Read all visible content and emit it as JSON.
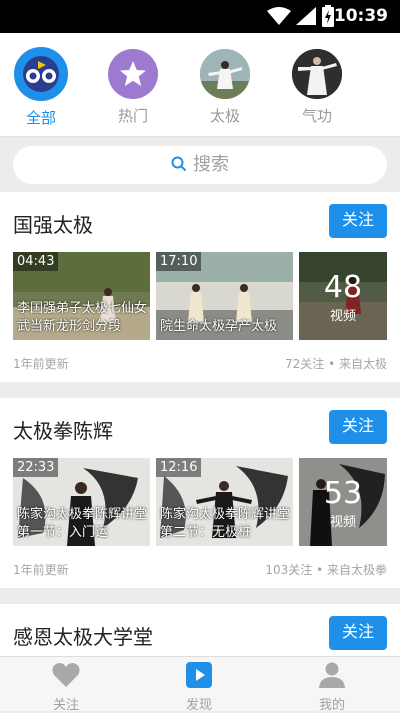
{
  "status_bar": {
    "time": "10:39"
  },
  "categories": [
    {
      "label": "全部",
      "active": true
    },
    {
      "label": "热门",
      "active": false
    },
    {
      "label": "太极",
      "active": false
    },
    {
      "label": "气功",
      "active": false
    }
  ],
  "search": {
    "placeholder": "搜索"
  },
  "cards": [
    {
      "title": "国强太极",
      "follow": "关注",
      "videos": [
        {
          "duration": "04:43",
          "caption": "李国强弟子太极七仙女武当新龙形剑分段"
        },
        {
          "duration": "17:10",
          "caption": "院生命太极孕产太极"
        }
      ],
      "count": "48",
      "count_unit": "视频",
      "updated": "1年前更新",
      "stats": "72关注 • 来自太极"
    },
    {
      "title": "太极拳陈辉",
      "follow": "关注",
      "videos": [
        {
          "duration": "22:33",
          "caption": "陈家沟太极拳陈辉讲堂 第一节：入门运"
        },
        {
          "duration": "12:16",
          "caption": "陈家沟太极拳陈辉讲堂 第二节：无极桩"
        }
      ],
      "count": "53",
      "count_unit": "视频",
      "updated": "1年前更新",
      "stats": "103关注 • 来自太极拳"
    },
    {
      "title": "感恩太极大学堂",
      "follow": "关注"
    }
  ],
  "bottom_nav": [
    {
      "label": "关注",
      "icon": "heart-icon",
      "active": false
    },
    {
      "label": "发现",
      "icon": "play-icon",
      "active": true
    },
    {
      "label": "我的",
      "icon": "person-icon",
      "active": false
    }
  ],
  "colors": {
    "accent": "#1e90ea",
    "background": "#ececec"
  }
}
